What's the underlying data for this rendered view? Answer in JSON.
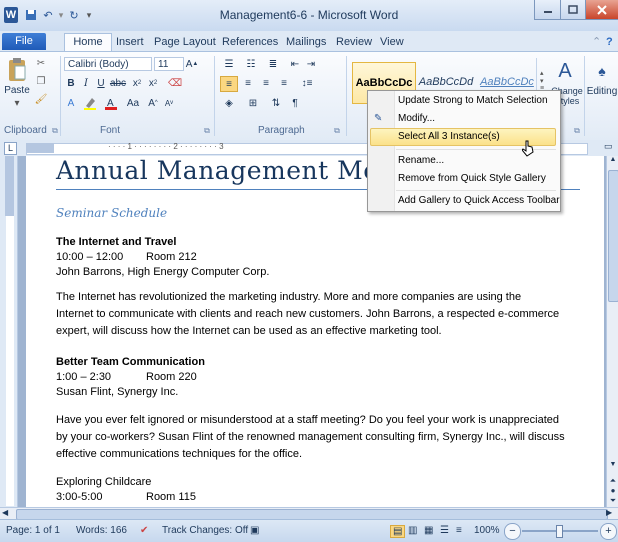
{
  "window": {
    "title": "Management6-6 - Microsoft Word"
  },
  "qat": {
    "word_icon": "W",
    "save_icon": "save-icon",
    "undo": "↶",
    "redo": "↻",
    "customize": "▾"
  },
  "tabs": [
    {
      "label": "File"
    },
    {
      "label": "Home"
    },
    {
      "label": "Insert"
    },
    {
      "label": "Page Layout"
    },
    {
      "label": "References"
    },
    {
      "label": "Mailings"
    },
    {
      "label": "Review"
    },
    {
      "label": "View"
    }
  ],
  "ribbon": {
    "clipboard": {
      "paste": "Paste",
      "label": "Clipboard"
    },
    "font": {
      "name": "Calibri (Body)",
      "size": "11",
      "label": "Font"
    },
    "paragraph": {
      "label": "Paragraph"
    },
    "styles": {
      "s1": "AaBbCcDc",
      "s2": "AaBbCcDd",
      "s3": "AaBbCcDc",
      "change": "Change",
      "change2": "Styles"
    },
    "editing": {
      "label": "Editing"
    }
  },
  "context_menu": {
    "items": [
      {
        "label": "Update Strong to Match Selection"
      },
      {
        "label": "Modify..."
      },
      {
        "label": "Select All 3 Instance(s)"
      },
      {
        "label": "Rename..."
      },
      {
        "label": "Remove from Quick Style Gallery"
      },
      {
        "label": "Add Gallery to Quick Access Toolbar"
      }
    ]
  },
  "document": {
    "title": "Annual Management Mee",
    "subtitle": "Seminar Schedule",
    "s1": {
      "heading": "The Internet and Travel",
      "time": "10:00 – 12:00",
      "room": "Room 212",
      "speaker": "John Barrons, High Energy Computer Corp."
    },
    "p1": [
      "The Internet has revolutionized the marketing industry. More and more companies are using the",
      "Internet to communicate with clients and reach new customers. John Barrons, a respected e-commerce",
      "expert, will discuss how the Internet can be used as an effective marketing tool."
    ],
    "s2": {
      "heading": "Better Team Communication",
      "time": "1:00 – 2:30",
      "room": "Room 220",
      "speaker": "Susan Flint, Synergy Inc."
    },
    "p2": [
      "Have you ever felt ignored or misunderstood at a staff meeting? Do you feel your work is unappreciated",
      "by your co-workers? Susan Flint of the renowned management consulting firm, Synergy Inc., will discuss",
      "effective communications techniques for the office."
    ],
    "s3": {
      "heading": "Exploring Childcare",
      "time": "3:00-5:00",
      "room": "Room 115"
    }
  },
  "status": {
    "page": "Page: 1 of 1",
    "words": "Words: 166",
    "track": "Track Changes: Off",
    "zoom": "100%"
  }
}
